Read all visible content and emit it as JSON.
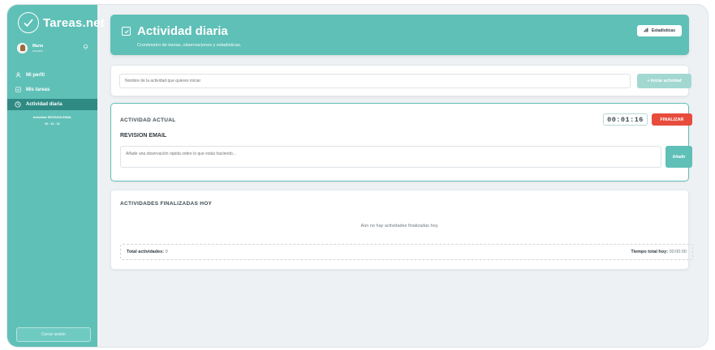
{
  "brand": {
    "name": "Tareas.net"
  },
  "user": {
    "name": "Maria",
    "role": "usuario"
  },
  "nav": {
    "items": [
      {
        "label": "Mi perfil",
        "icon": "user-icon"
      },
      {
        "label": "Mis tareas",
        "icon": "checkbox-icon"
      },
      {
        "label": "Actividad diaria",
        "icon": "clock-icon",
        "active": true
      }
    ]
  },
  "sidebar_live": {
    "activity": "Actividad: REVISION EMAIL",
    "time": "00 : 01 : 16"
  },
  "logout_label": "Cerrar sesión",
  "header": {
    "title": "Actividad diaria",
    "subtitle": "Cronómetro de tareas, observaciones y estadísticas.",
    "stats_button": "Estadísticas"
  },
  "start": {
    "placeholder": "Nombre de la actividad que quieres iniciar",
    "button": "+ Iniciar actividad"
  },
  "current": {
    "label": "ACTIVIDAD ACTUAL",
    "name": "REVISION EMAIL",
    "timer": "00:01:16",
    "finish_button": "FINALIZAR",
    "obs_placeholder": "Añade una observación rápida sobre lo que estás haciendo...",
    "add_button": "Añadir"
  },
  "finished": {
    "label": "ACTIVIDADES FINALIZADAS HOY",
    "empty": "Aún no hay actividades finalizadas hoy.",
    "total_label": "Total actividades:",
    "total_value": "0",
    "time_label": "Tiempo total hoy:",
    "time_value": "00:00:00"
  },
  "colors": {
    "accent": "#5fc0b7",
    "accent_dark": "#2f8a84",
    "danger": "#e74c3c"
  }
}
